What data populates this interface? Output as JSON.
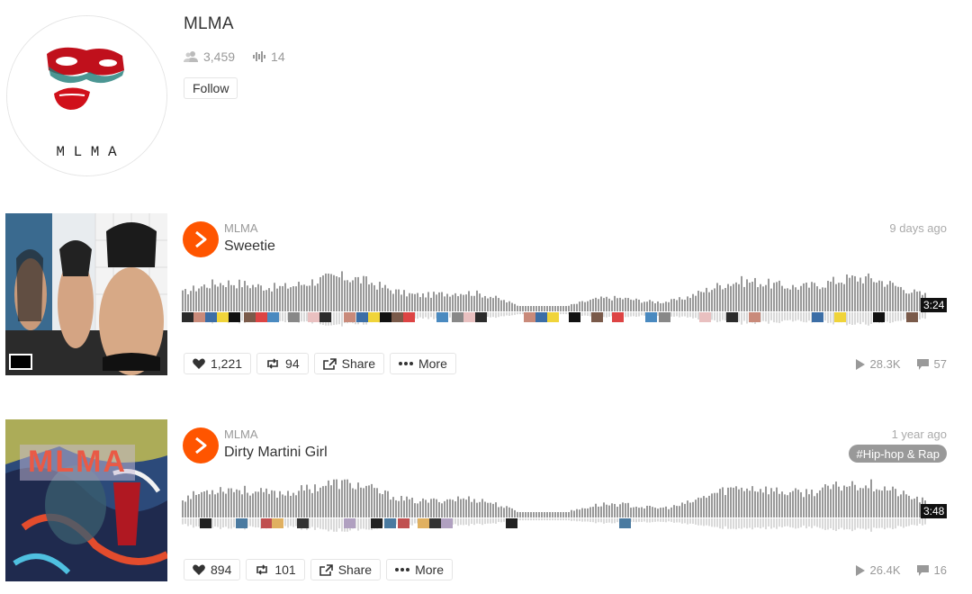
{
  "profile": {
    "name": "MLMA",
    "followers": "3,459",
    "tracks": "14",
    "follow_label": "Follow",
    "avatar_text": "M L M A"
  },
  "tracks": [
    {
      "artist": "MLMA",
      "title": "Sweetie",
      "posted": "9 days ago",
      "duration": "3:24",
      "likes": "1,221",
      "reposts": "94",
      "share_label": "Share",
      "more_label": "More",
      "plays": "28.3K",
      "comments": "57"
    },
    {
      "artist": "MLMA",
      "title": "Dirty Martini Girl",
      "posted": "1 year ago",
      "genre": "Hip-hop & Rap",
      "duration": "3:48",
      "likes": "894",
      "reposts": "101",
      "share_label": "Share",
      "more_label": "More",
      "plays": "26.4K",
      "comments": "16"
    }
  ],
  "colors": {
    "accent": "#ff5500",
    "waveform": "#999999",
    "muted_text": "#999999"
  }
}
